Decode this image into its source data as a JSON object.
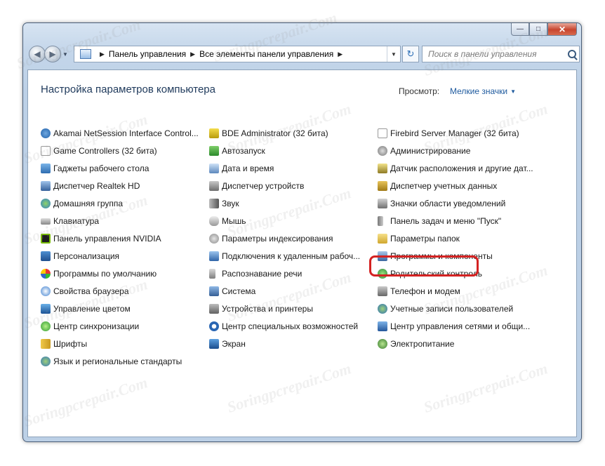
{
  "window": {
    "minimize_label": "—",
    "maximize_label": "□",
    "close_label": "✕"
  },
  "nav": {
    "back_label": "◀",
    "forward_label": "▶",
    "dropdown_label": "▼",
    "refresh_label": "↻"
  },
  "address": {
    "breadcrumbs": [
      "Панель управления",
      "Все элементы панели управления"
    ],
    "separator": "▶"
  },
  "search": {
    "placeholder": "Поиск в панели управления"
  },
  "header": {
    "title": "Настройка параметров компьютера",
    "view_label": "Просмотр:",
    "view_value": "Мелкие значки",
    "view_caret": "▼"
  },
  "items": {
    "col1": [
      "Akamai NetSession Interface Control...",
      "Game Controllers (32 бита)",
      "Гаджеты рабочего стола",
      "Диспетчер Realtek HD",
      "Домашняя группа",
      "Клавиатура",
      "Панель управления NVIDIA",
      "Персонализация",
      "Программы по умолчанию",
      "Свойства браузера",
      "Управление цветом",
      "Центр синхронизации",
      "Шрифты",
      "Язык и региональные стандарты"
    ],
    "col2": [
      "BDE Administrator (32 бита)",
      "Автозапуск",
      "Дата и время",
      "Диспетчер устройств",
      "Звук",
      "Мышь",
      "Параметры индексирования",
      "Подключения к удаленным рабоч...",
      "Распознавание речи",
      "Система",
      "Устройства и принтеры",
      "Центр специальных возможностей",
      "Экран"
    ],
    "col3": [
      "Firebird Server Manager (32 бита)",
      "Администрирование",
      "Датчик расположения и другие дат...",
      "Диспетчер учетных данных",
      "Значки области уведомлений",
      "Панель задач и меню \"Пуск\"",
      "Параметры папок",
      "Программы и компоненты",
      "Родительский контроль",
      "Телефон и модем",
      "Учетные записи пользователей",
      "Центр управления сетями и общи...",
      "Электропитание"
    ]
  },
  "watermark_text": "Soringpcrepair.Com",
  "colors": {
    "title": "#1e395b",
    "link": "#1e5a9e",
    "highlight": "#d42222"
  }
}
